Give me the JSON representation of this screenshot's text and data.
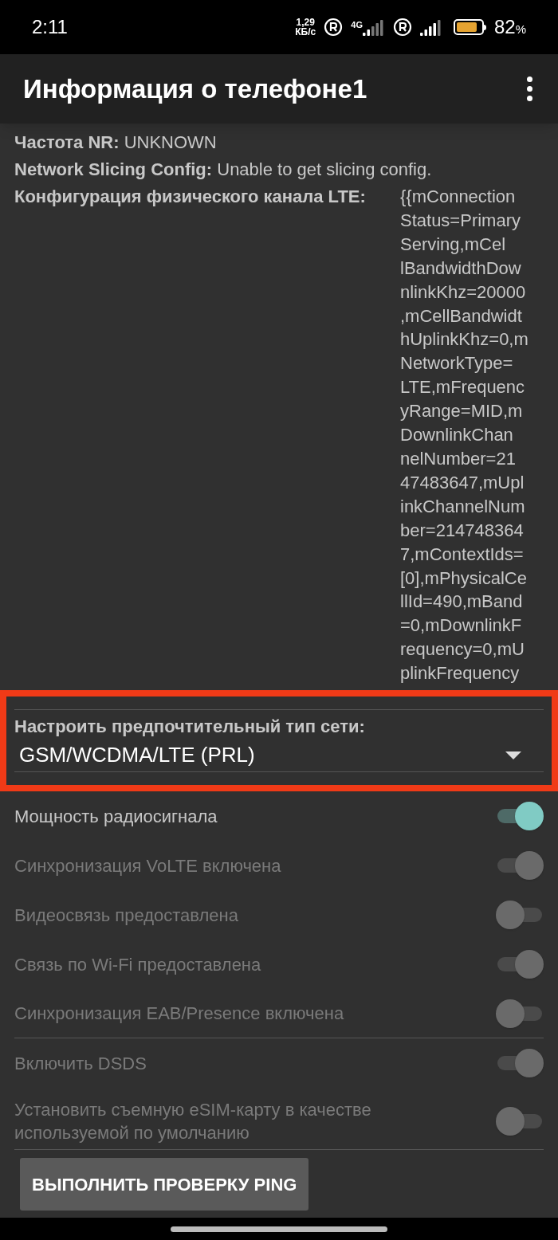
{
  "status_bar": {
    "time": "2:11",
    "speed_value": "1,29",
    "speed_unit": "КБ/с",
    "network_type": "4G",
    "battery_percent": "82",
    "percent_sign": "%"
  },
  "app_bar": {
    "title": "Информация о телефоне1"
  },
  "info": [
    {
      "label": "Частота NR:",
      "value": "UNKNOWN"
    },
    {
      "label": "Network Slicing Config:",
      "value": "Unable to get slicing config."
    }
  ],
  "lte_config": {
    "label": "Конфигурация физического канала LTE:",
    "value_lines": [
      "{{mConnection",
      "Status=Primary",
      "Serving,mCel",
      "lBandwidthDow",
      "nlinkKhz=20000",
      ",mCellBandwidt",
      "hUplinkKhz=0,m",
      "NetworkType=",
      "LTE,mFrequenc",
      "yRange=MID,m",
      "DownlinkChan",
      "nelNumber=21",
      "47483647,mUpl",
      "inkChannelNum",
      "ber=214748364",
      "7,mContextIds=",
      "[0],mPhysicalCe",
      "llId=490,mBand",
      "=0,mDownlinkF",
      "requency=0,mU",
      "plinkFrequency"
    ]
  },
  "network_type": {
    "label": "Настроить предпочтительный тип сети:",
    "value": "GSM/WCDMA/LTE (PRL)",
    "highlighted": true
  },
  "switches": [
    {
      "label": "Мощность радиосигнала",
      "on": true,
      "disabled": false,
      "divider": false
    },
    {
      "label": "Синхронизация VoLTE включена",
      "on": true,
      "disabled": true,
      "divider": false
    },
    {
      "label": "Видеосвязь предоставлена",
      "on": false,
      "disabled": true,
      "divider": false
    },
    {
      "label": "Связь по Wi-Fi предоставлена",
      "on": true,
      "disabled": true,
      "divider": false
    },
    {
      "label": "Синхронизация EAB/Presence включена",
      "on": false,
      "disabled": true,
      "divider": true
    },
    {
      "label": "Включить DSDS",
      "on": true,
      "disabled": true,
      "divider": false
    },
    {
      "label": "Установить съемную eSIM-карту в качестве используемой по умолчанию",
      "on": false,
      "disabled": true,
      "divider": true
    }
  ],
  "ping_button": {
    "label": "ВЫПОЛНИТЬ ПРОВЕРКУ PING"
  }
}
